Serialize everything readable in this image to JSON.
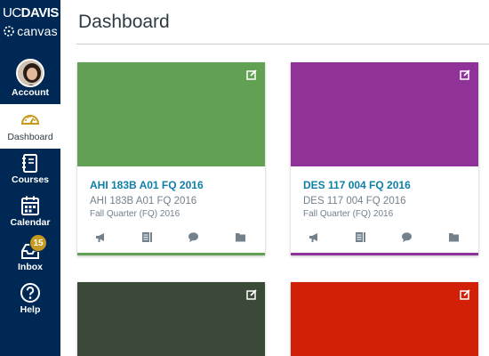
{
  "brand": {
    "uc": "UC",
    "davis": "DAVIS",
    "canvas": "canvas"
  },
  "nav": {
    "account": "Account",
    "dashboard": "Dashboard",
    "courses": "Courses",
    "calendar": "Calendar",
    "inbox": "Inbox",
    "inbox_badge": "15",
    "help": "Help"
  },
  "header": {
    "title": "Dashboard"
  },
  "colors": {
    "sidebar": "#002855",
    "accent": "#c79a1f",
    "link": "#0f7ea8"
  },
  "cards": [
    {
      "color": "#62a153",
      "title": "AHI 183B A01 FQ 2016",
      "subtitle": "AHI 183B A01 FQ 2016",
      "term": "Fall Quarter (FQ) 2016",
      "icons": [
        "announcements-icon",
        "assignments-icon",
        "discussions-icon",
        "files-icon"
      ]
    },
    {
      "color": "#8f3399",
      "title": "DES 117 004 FQ 2016",
      "subtitle": "DES 117 004 FQ 2016",
      "term": "Fall Quarter (FQ) 2016",
      "icons": [
        "announcements-icon",
        "assignments-icon",
        "discussions-icon",
        "files-icon"
      ]
    },
    {
      "color": "#3b4a38",
      "title": "",
      "subtitle": "",
      "term": ""
    },
    {
      "color": "#d12007",
      "title": "",
      "subtitle": "",
      "term": ""
    }
  ]
}
